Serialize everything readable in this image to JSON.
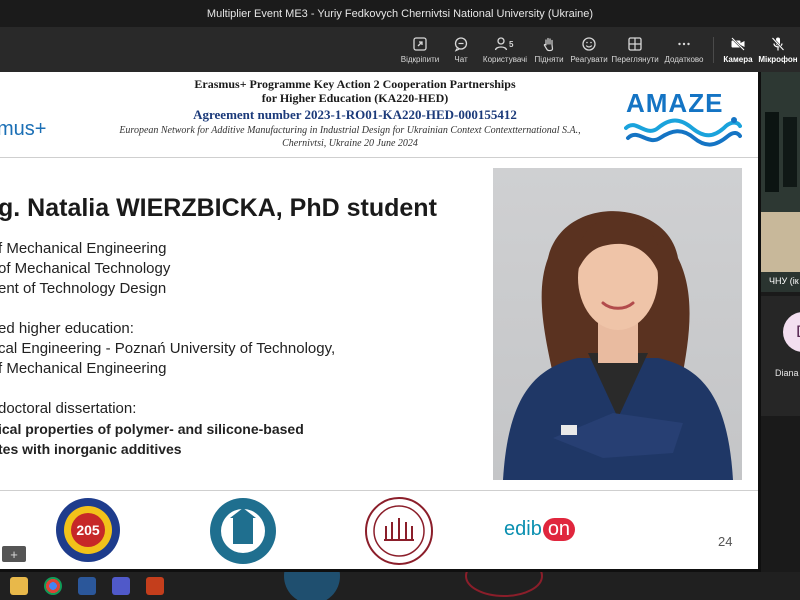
{
  "window": {
    "title": "Multiplier Event ME3 - Yuriy Fedkovych Chernivtsi National University (Ukraine)"
  },
  "toolbar": {
    "share": "Відкріпити",
    "chat": "Чат",
    "people": "Користувачі",
    "people_count": "5",
    "raise": "Підняти",
    "react": "Реагувати",
    "view": "Переглянути",
    "more": "Додатково",
    "camera": "Камера",
    "mic": "Мікрофон"
  },
  "slide": {
    "header_line1": "Erasmus+ Programme Key Action 2 Cooperation Partnerships",
    "header_line2": "for Higher Education (KA220-HED)",
    "agreement": "Agreement number 2023-1-RO01-KA220-HED-000155412",
    "network_line1": "European Network for Additive Manufacturing in Industrial Design for Ukrainian Context Contextternational S.A.,",
    "network_line2": "Chernivtsi, Ukraine 20 June 2024",
    "logo_left": "mus+",
    "logo_right": "AMAZE",
    "name": "g. Natalia WIERZBICKA, PhD student",
    "lines": [
      "f Mechanical Engineering",
      "of Mechanical Technology",
      "ent of Technology Design",
      "ed higher education:",
      "cal Engineering - Poznań University of Technology,",
      "f Mechanical Engineering",
      "doctoral dissertation:",
      "ical properties of polymer- and silicone-based",
      "tes with inorganic additives"
    ],
    "footer_logo_205": "205",
    "edibon_pre": "edib",
    "edibon_on": "on",
    "page_number": "24"
  },
  "participants": [
    {
      "label": "ЧНУ (ік"
    },
    {
      "initial": "D",
      "name": "Diana I"
    }
  ],
  "zoom": {
    "label": "+"
  },
  "colors": {
    "accent_blue": "#1474c4",
    "agreement_blue": "#1b3a7a",
    "edibon_red": "#e0263d"
  }
}
